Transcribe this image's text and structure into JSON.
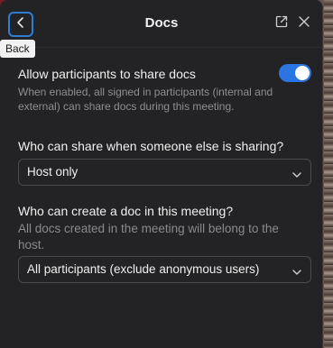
{
  "header": {
    "title": "Docs",
    "back_tooltip": "Back",
    "back_icon": "chevron-left-icon",
    "popout_icon": "popout-icon",
    "close_icon": "close-icon"
  },
  "share_docs": {
    "title": "Allow participants to share docs",
    "description": "When enabled, all signed in participants (internal and external) can share docs during this meeting.",
    "enabled": true
  },
  "share_when_sharing": {
    "title": "Who can share when someone else is sharing?",
    "selected": "Host only"
  },
  "create_doc": {
    "title": "Who can create a doc in this meeting?",
    "description": "All docs created in the meeting will belong to the host.",
    "selected": "All participants (exclude anonymous users)"
  },
  "colors": {
    "panel_bg": "#232325",
    "accent": "#2b74e4",
    "focus_ring": "#2d7fd6",
    "text_primary": "#f0f0f0",
    "text_secondary": "#8e8e93"
  }
}
